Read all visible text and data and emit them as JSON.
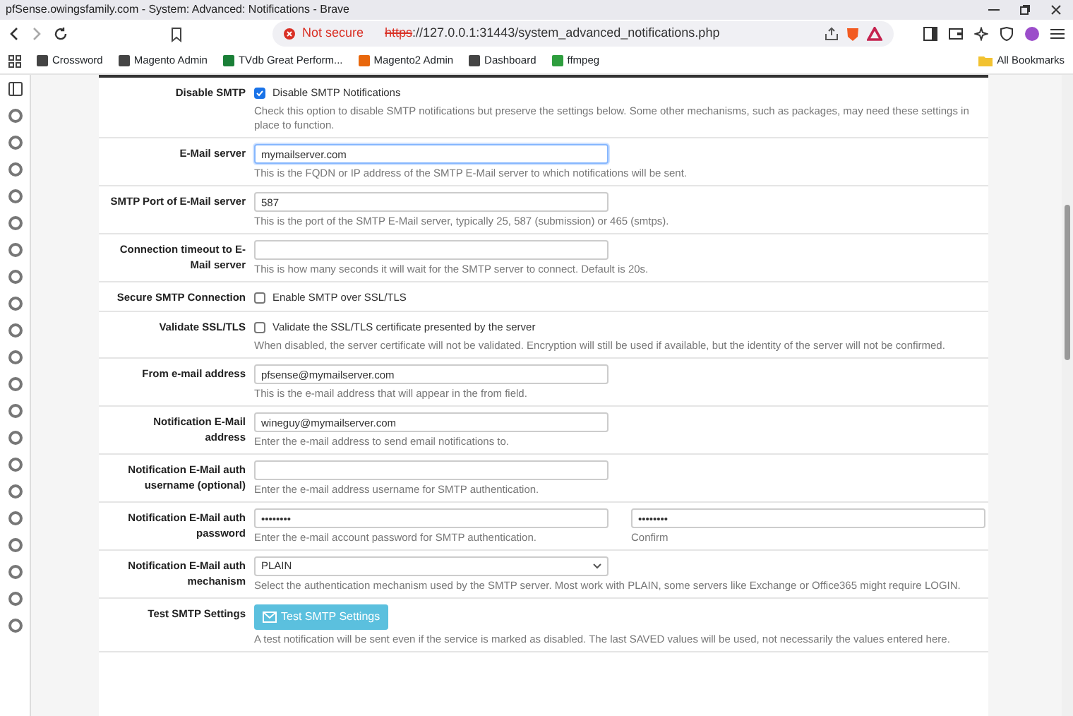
{
  "window": {
    "title": "pfSense.owingsfamily.com - System: Advanced: Notifications - Brave"
  },
  "address_bar": {
    "security": "Not secure",
    "scheme": "https",
    "rest": "://127.0.0.1:31443/system_advanced_notifications.php"
  },
  "bookmarks": [
    {
      "label": "Crossword"
    },
    {
      "label": "Magento Admin"
    },
    {
      "label": "TVdb Great Perform..."
    },
    {
      "label": "Magento2 Admin"
    },
    {
      "label": "Dashboard"
    },
    {
      "label": "ffmpeg"
    }
  ],
  "all_bookmarks": "All Bookmarks",
  "form_rows": [
    {
      "kind": "checkbox",
      "label": "Disable SMTP",
      "checked": true,
      "option": "Disable SMTP Notifications",
      "help": "Check this option to disable SMTP notifications but preserve the settings below. Some other mechanisms, such as packages, may need these settings in place to function."
    },
    {
      "kind": "text",
      "label": "E-Mail server",
      "value": "mymailserver.com",
      "focused": true,
      "help": "This is the FQDN or IP address of the SMTP E-Mail server to which notifications will be sent."
    },
    {
      "kind": "text",
      "label": "SMTP Port of E-Mail server",
      "value": "587",
      "focused": false,
      "help": "This is the port of the SMTP E-Mail server, typically 25, 587 (submission) or 465 (smtps)."
    },
    {
      "kind": "text",
      "label": "Connection timeout to E-Mail server",
      "value": "",
      "focused": false,
      "help": "This is how many seconds it will wait for the SMTP server to connect. Default is 20s."
    },
    {
      "kind": "checkbox",
      "label": "Secure SMTP Connection",
      "checked": false,
      "option": "Enable SMTP over SSL/TLS"
    },
    {
      "kind": "checkbox",
      "label": "Validate SSL/TLS",
      "checked": false,
      "option": "Validate the SSL/TLS certificate presented by the server",
      "help": "When disabled, the server certificate will not be validated. Encryption will still be used if available, but the identity of the server will not be confirmed."
    },
    {
      "kind": "text",
      "label": "From e-mail address",
      "value": "pfsense@mymailserver.com",
      "focused": false,
      "help": "This is the e-mail address that will appear in the from field."
    },
    {
      "kind": "text",
      "label": "Notification E-Mail address",
      "value": "wineguy@mymailserver.com",
      "focused": false,
      "help": "Enter the e-mail address to send email notifications to."
    },
    {
      "kind": "text",
      "label": "Notification E-Mail auth username (optional)",
      "value": "",
      "focused": false,
      "help": "Enter the e-mail address username for SMTP authentication."
    },
    {
      "kind": "password",
      "label": "Notification E-Mail auth password",
      "value": "••••••••",
      "confirm_value": "••••••••",
      "help": "Enter the e-mail account password for SMTP authentication.",
      "confirm_help": "Confirm"
    },
    {
      "kind": "select",
      "label": "Notification E-Mail auth mechanism",
      "value": "PLAIN",
      "help": "Select the authentication mechanism used by the SMTP server. Most work with PLAIN, some servers like Exchange or Office365 might require LOGIN."
    },
    {
      "kind": "button",
      "label": "Test SMTP Settings",
      "button": "Test SMTP Settings",
      "help": "A test notification will be sent even if the service is marked as disabled. The last SAVED values will be used, not necessarily the values entered here."
    }
  ]
}
